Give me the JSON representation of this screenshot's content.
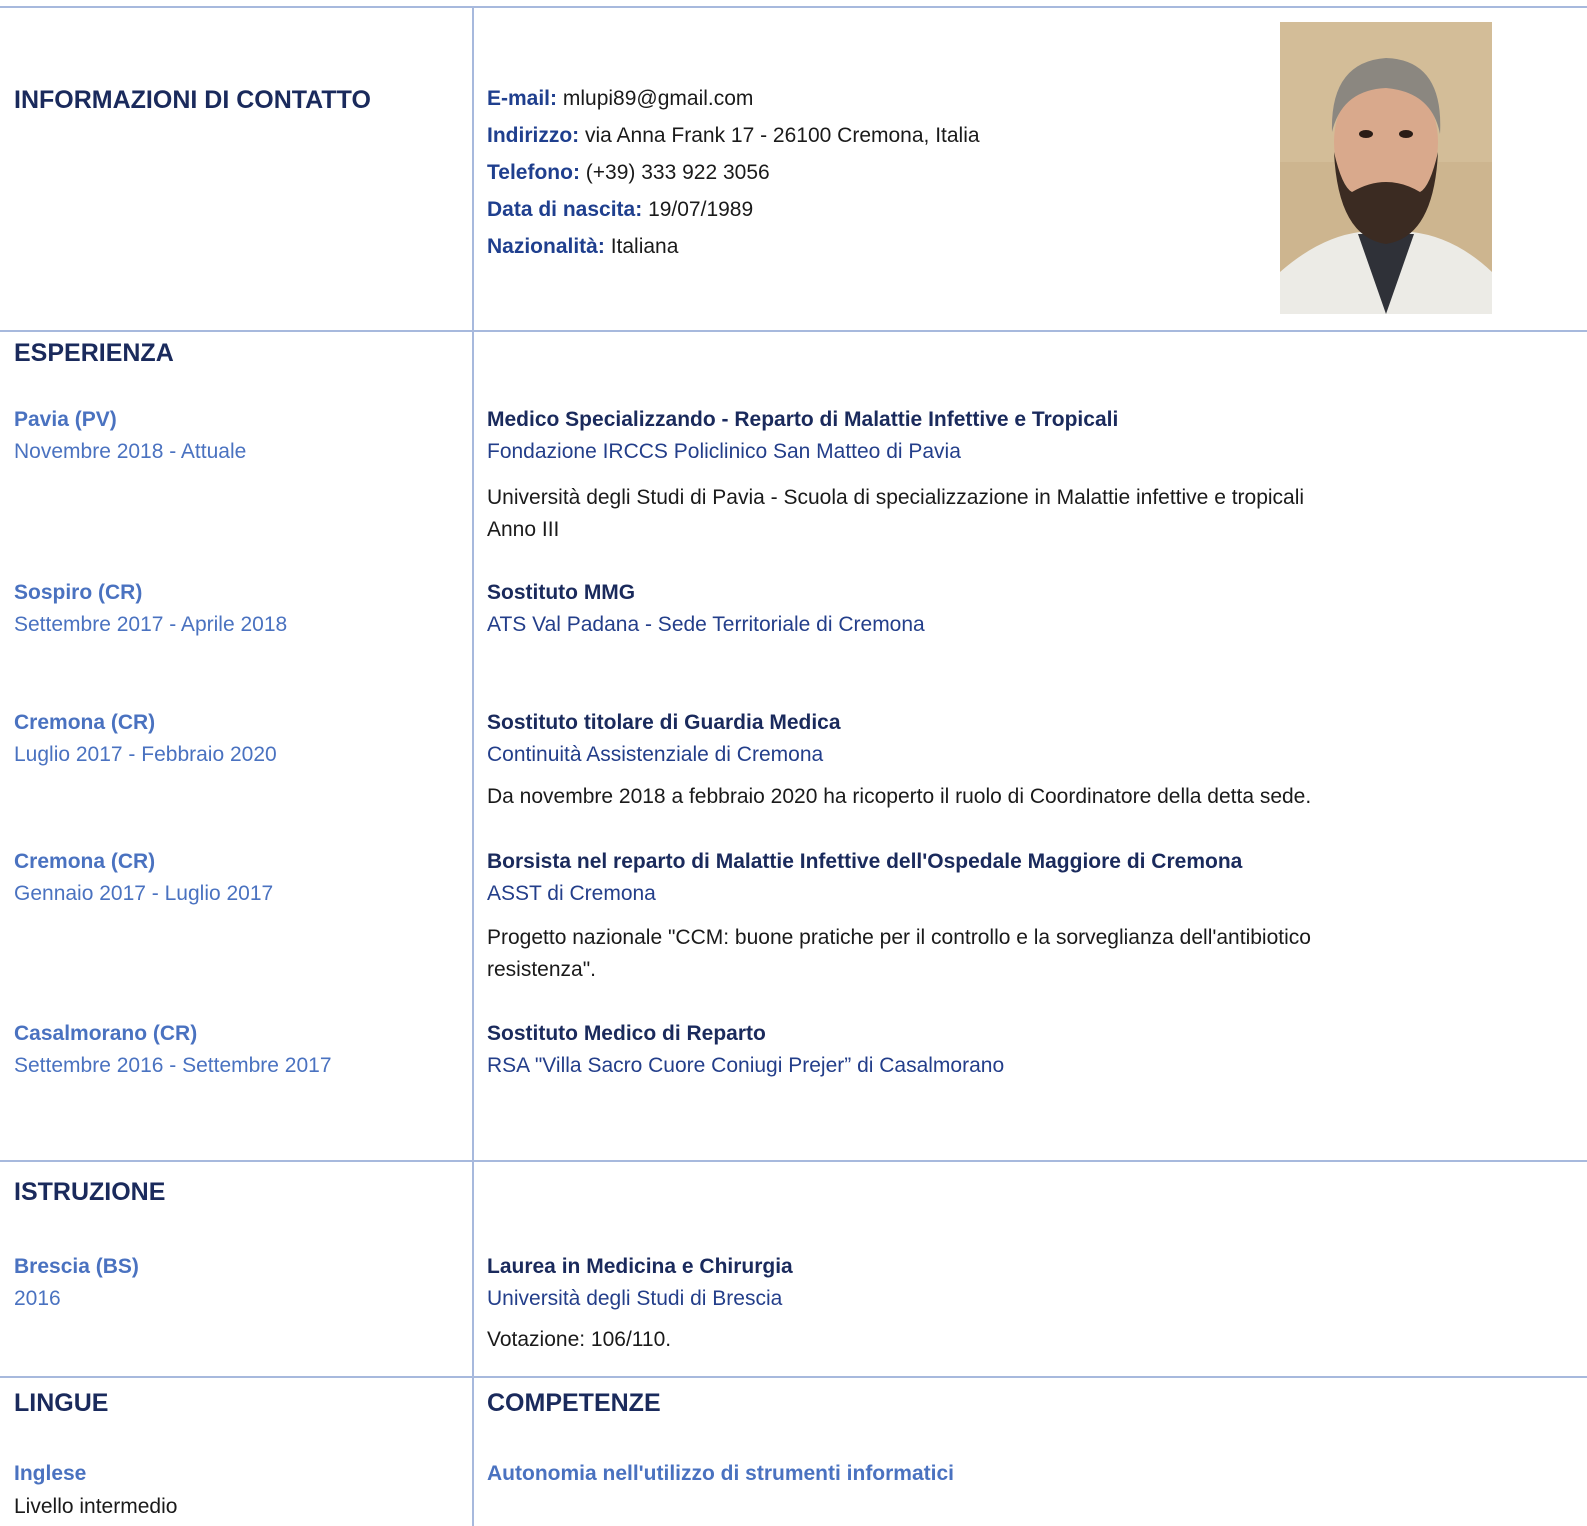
{
  "contact": {
    "title": "INFORMAZIONI DI CONTATTO",
    "email_label": "E-mail:",
    "email": "mlupi89@gmail.com",
    "address_label": "Indirizzo:",
    "address": "via Anna Frank 17 - 26100 Cremona, Italia",
    "phone_label": "Telefono:",
    "phone": "(+39) 333 922 3056",
    "birth_label": "Data di nascita:",
    "birth": "19/07/1989",
    "nationality_label": "Nazionalità:",
    "nationality": "Italiana"
  },
  "experience": {
    "title": "ESPERIENZA",
    "items": [
      {
        "place": "Pavia (PV)",
        "date": "Novembre 2018 - Attuale",
        "role": "Medico Specializzando - Reparto di Malattie Infettive e Tropicali",
        "org": "Fondazione IRCCS Policlinico San Matteo di Pavia",
        "desc": "Università degli Studi di Pavia - Scuola di specializzazione in Malattie infettive e tropicali",
        "desc2": "Anno III"
      },
      {
        "place": "Sospiro (CR)",
        "date": "Settembre 2017 - Aprile 2018",
        "role": "Sostituto MMG",
        "org": "ATS Val Padana - Sede Territoriale di Cremona"
      },
      {
        "place": "Cremona (CR)",
        "date": "Luglio 2017 - Febbraio 2020",
        "role": "Sostituto titolare di Guardia Medica",
        "org": "Continuità Assistenziale di Cremona",
        "desc": "Da novembre 2018 a febbraio 2020 ha ricoperto il ruolo di Coordinatore della detta sede."
      },
      {
        "place": "Cremona (CR)",
        "date": "Gennaio 2017 - Luglio 2017",
        "role": "Borsista nel reparto di Malattie Infettive dell'Ospedale Maggiore di Cremona",
        "org": "ASST di Cremona",
        "desc": "Progetto nazionale \"CCM: buone pratiche per il controllo e la sorveglianza dell'antibiotico",
        "desc2": "resistenza\"."
      },
      {
        "place": "Casalmorano (CR)",
        "date": "Settembre 2016 - Settembre 2017",
        "role": "Sostituto Medico di Reparto",
        "org": "RSA \"Villa Sacro Cuore Coniugi Prejer” di Casalmorano"
      }
    ]
  },
  "education": {
    "title": "ISTRUZIONE",
    "items": [
      {
        "place": "Brescia (BS)",
        "date": "2016",
        "role": "Laurea in Medicina e Chirurgia",
        "org": "Università degli Studi di Brescia",
        "desc": "Votazione: 106/110."
      }
    ]
  },
  "languages": {
    "title": "LINGUE",
    "items": [
      {
        "name": "Inglese",
        "level": "Livello intermedio"
      }
    ]
  },
  "skills": {
    "title": "COMPETENZE",
    "items": [
      {
        "name": "Autonomia nell'utilizzo di strumenti informatici"
      }
    ]
  }
}
